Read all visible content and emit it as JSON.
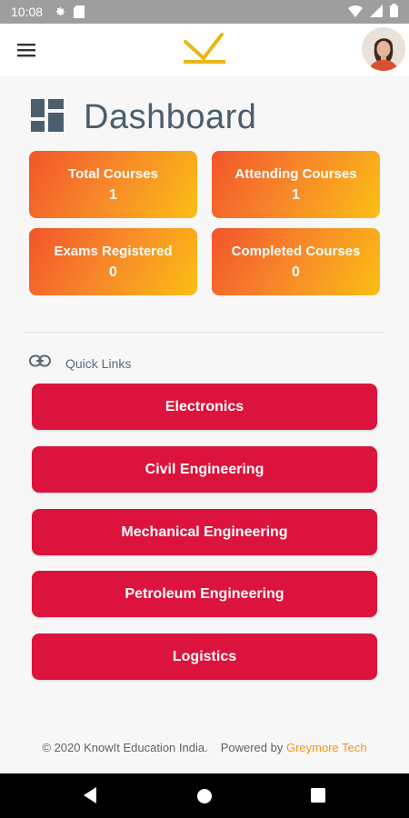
{
  "status_bar": {
    "time": "10:08",
    "icons_left": [
      "settings-icon",
      "sd-card-icon"
    ],
    "icons_right": [
      "wifi-icon",
      "signal-icon",
      "battery-icon"
    ]
  },
  "app_bar": {
    "menu_icon": "hamburger-menu-icon",
    "logo": "knowit-logo",
    "avatar": "user-avatar"
  },
  "dashboard": {
    "title": "Dashboard",
    "icon": "dashboard-grid-icon"
  },
  "stats": [
    {
      "label": "Total Courses",
      "value": "1"
    },
    {
      "label": "Attending Courses",
      "value": "1"
    },
    {
      "label": "Exams Registered",
      "value": "0"
    },
    {
      "label": "Completed Courses",
      "value": "0"
    }
  ],
  "quick_links": {
    "title": "Quick Links",
    "icon": "link-icon",
    "items": [
      "Electronics",
      "Civil Engineering",
      "Mechanical Engineering",
      "Petroleum Engineering",
      "Logistics"
    ]
  },
  "footer": {
    "copyright": "© 2020 KnowIt Education India.",
    "powered_by": "Powered by",
    "brand": "Greymore Tech"
  },
  "colors": {
    "card_gradient_start": "#f2552a",
    "card_gradient_end": "#fbbf14",
    "link_button": "#dc133c",
    "brand_accent": "#f7921e",
    "logo": "#e8b616"
  },
  "nav_bar": {
    "icons": [
      "back-icon",
      "home-icon",
      "recents-icon"
    ]
  }
}
